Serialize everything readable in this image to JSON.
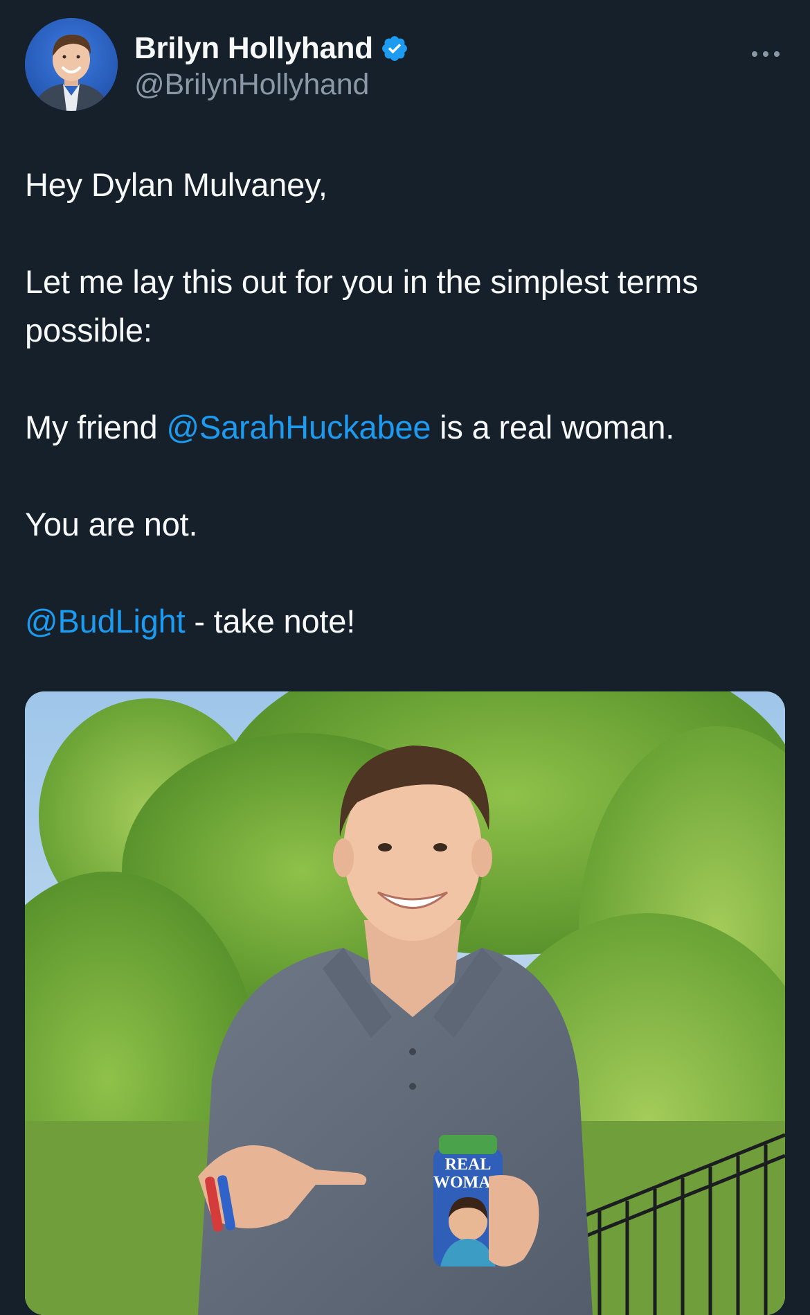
{
  "tweet": {
    "author": {
      "display_name": "Brilyn Hollyhand",
      "handle": "@BrilynHollyhand",
      "verified": true,
      "avatar_icon": "profile-photo"
    },
    "more_icon": "more-horizontal-icon",
    "body": {
      "greeting": "Hey Dylan Mulvaney,",
      "line2": "Let me lay this out for you in the simplest terms possible:",
      "line3_prefix": "My friend ",
      "line3_mention": "@SarahHuckabee",
      "line3_suffix": " is a real woman.",
      "line4": "You are not.",
      "line5_mention": "@BudLight",
      "line5_suffix": " - take note!"
    },
    "media": {
      "description_icon": "attached-photo",
      "koozie_text_line1": "REAL",
      "koozie_text_line2": "WOMAN"
    }
  },
  "colors": {
    "background": "#15202b",
    "text": "#f7f9f9",
    "secondary_text": "#8b98a5",
    "link": "#1d9bf0",
    "verified_badge": "#1d9bf0"
  }
}
